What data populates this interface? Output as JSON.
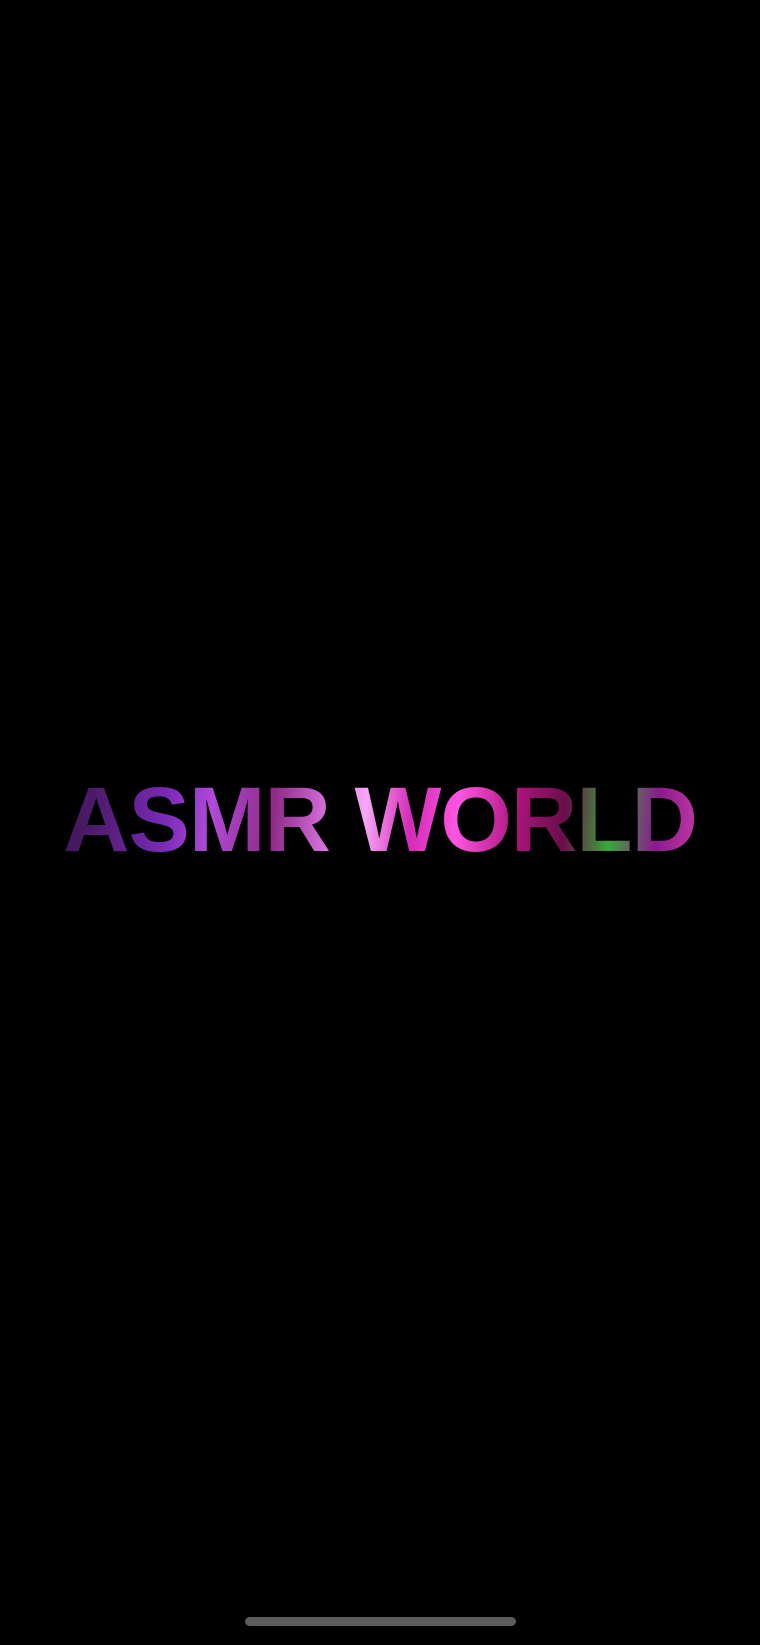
{
  "splash": {
    "logo_text": "ASMR WORLD"
  },
  "colors": {
    "background": "#000000",
    "logo_primary": "#c03ac8",
    "logo_accent_green": "#3aa83a",
    "home_indicator": "#5c5c5c"
  }
}
